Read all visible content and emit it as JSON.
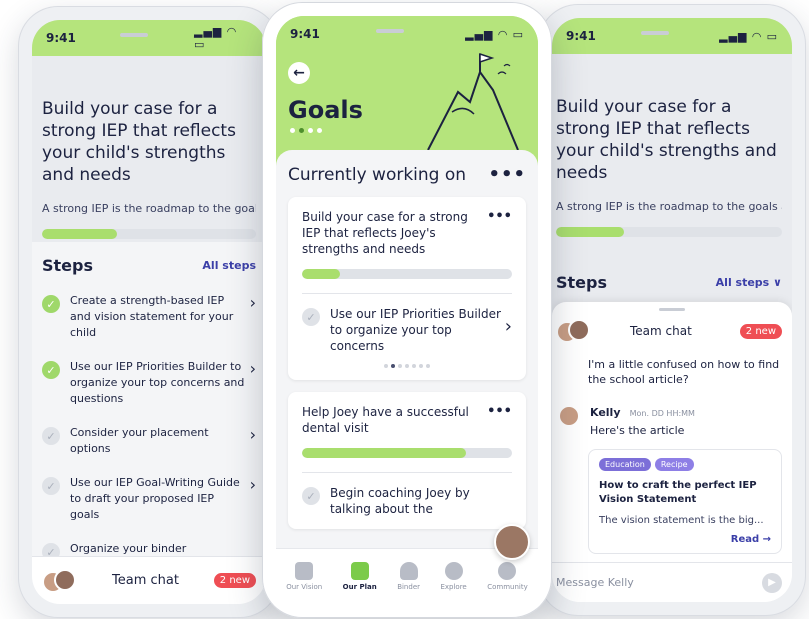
{
  "status_time": "9:41",
  "left": {
    "title": "Build your case for a strong IEP that reflects your child's strengths and needs",
    "subtitle": "A strong IEP is the roadmap to the goals and...",
    "progress": 0.35,
    "steps_heading": "Steps",
    "all_steps_label": "All steps",
    "steps": [
      {
        "label": "Create a strength-based IEP and vision statement for your child",
        "done": true
      },
      {
        "label": "Use our IEP Priorities Builder to organize your top concerns and questions",
        "done": true
      },
      {
        "label": "Consider your placement options",
        "done": false
      },
      {
        "label": "Use our IEP Goal-Writing Guide to draft your proposed IEP goals",
        "done": false
      },
      {
        "label": "Organize your binder",
        "done": false
      }
    ],
    "team_chat_label": "Team chat",
    "badge": "2 new"
  },
  "center": {
    "title": "Goals",
    "section_heading": "Currently working on",
    "menu_glyph": "•••",
    "goals": [
      {
        "title": "Build your case for a strong IEP that reflects Joey's strengths and needs",
        "progress": 0.18,
        "sub_task": "Use our IEP Priorities Builder to organize your top concerns"
      },
      {
        "title": "Help Joey have a successful dental visit",
        "progress": 0.78,
        "sub_task": "Begin coaching Joey by talking about the"
      }
    ],
    "tabs": [
      {
        "label": "Our Vision",
        "active": false
      },
      {
        "label": "Our Plan",
        "active": true
      },
      {
        "label": "Binder",
        "active": false
      },
      {
        "label": "Explore",
        "active": false
      },
      {
        "label": "Community",
        "active": false
      }
    ]
  },
  "right": {
    "title": "Build your case for a strong IEP that reflects your child's strengths and needs",
    "subtitle": "A strong IEP is the roadmap to the goals and...",
    "progress": 0.3,
    "steps_heading": "Steps",
    "all_steps_label": "All steps ∨",
    "chat": {
      "title": "Team chat",
      "badge": "2 new",
      "prev_message": "I'm a little confused on how to find the school article?",
      "sender": "Kelly",
      "timestamp": "Mon. DD HH:MM",
      "message": "Here's the article",
      "tags": [
        "Education",
        "Recipe"
      ],
      "article_title": "How to craft the perfect IEP Vision Statement",
      "article_desc": "The vision statement is the big...",
      "read_label": "Read →",
      "input_placeholder": "Message Kelly"
    }
  },
  "colors": {
    "accent_green": "#b5e47c",
    "progress_fill": "#a9de6d",
    "badge_red": "#ef4e54",
    "link_indigo": "#3b3fa8",
    "tag_purple": "#7c6fd8"
  }
}
